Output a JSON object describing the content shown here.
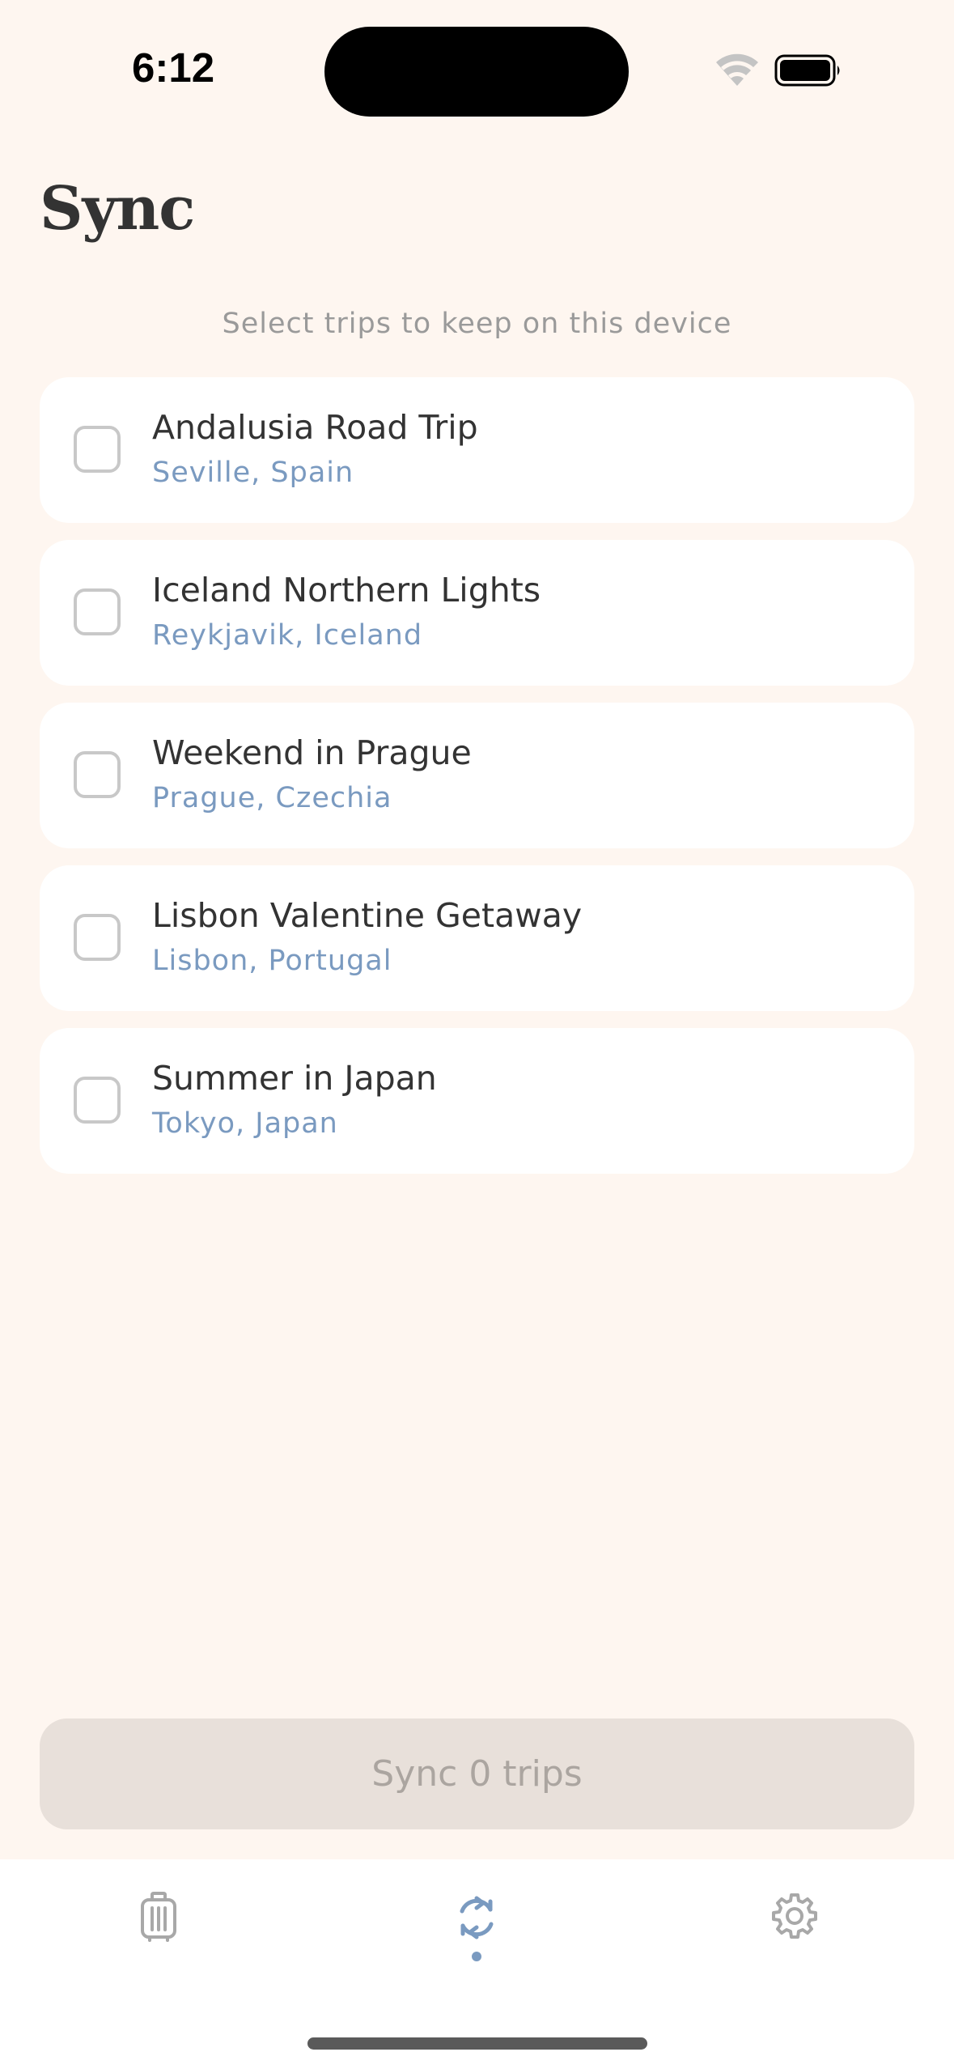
{
  "status_bar": {
    "time": "6:12",
    "wifi_icon": "wifi-icon",
    "battery_icon": "battery-icon"
  },
  "header": {
    "title": "Sync",
    "subtitle": "Select trips to keep on this device"
  },
  "trips": [
    {
      "name": "Andalusia Road Trip",
      "location": "Seville, Spain",
      "checked": false
    },
    {
      "name": "Iceland Northern Lights",
      "location": "Reykjavik, Iceland",
      "checked": false
    },
    {
      "name": "Weekend in Prague",
      "location": "Prague, Czechia",
      "checked": false
    },
    {
      "name": "Lisbon Valentine Getaway",
      "location": "Lisbon, Portugal",
      "checked": false
    },
    {
      "name": "Summer in Japan",
      "location": "Tokyo, Japan",
      "checked": false
    }
  ],
  "sync_button": {
    "label": "Sync 0 trips",
    "enabled": false
  },
  "tab_bar": {
    "tabs": [
      {
        "icon": "luggage-icon",
        "active": false
      },
      {
        "icon": "sync-icon",
        "active": true
      },
      {
        "icon": "gear-icon",
        "active": false
      }
    ]
  },
  "colors": {
    "background": "#FEF6F0",
    "card": "#FFFFFF",
    "accent": "#7A9AC0",
    "text": "#333333",
    "muted": "#9A9A9A",
    "button_disabled": "#E8E0DA"
  }
}
